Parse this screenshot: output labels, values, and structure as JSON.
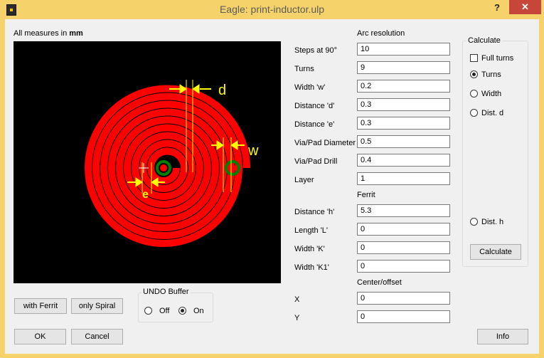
{
  "window": {
    "title": "Eagle: print-inductor.ulp",
    "help_label": "?",
    "close_label": "✕"
  },
  "preview": {
    "measures_prefix": "All measures in ",
    "measures_unit": "mm",
    "label_d": "d",
    "label_w": "w",
    "label_e": "e"
  },
  "arc": {
    "heading": "Arc resolution",
    "fields": [
      {
        "label": "Steps at 90°",
        "value": "10"
      },
      {
        "label": "Turns",
        "value": "9"
      },
      {
        "label": "Width 'w'",
        "value": "0.2"
      },
      {
        "label": "Distance 'd'",
        "value": "0.3"
      },
      {
        "label": "Distance 'e'",
        "value": "0.3"
      },
      {
        "label": "Via/Pad Diameter",
        "value": "0.5"
      },
      {
        "label": "Via/Pad Drill",
        "value": "0.4"
      },
      {
        "label": "Layer",
        "value": "1"
      }
    ]
  },
  "ferrit": {
    "heading": "Ferrit",
    "fields": [
      {
        "label": "Distance 'h'",
        "value": "5.3"
      },
      {
        "label": "Length 'L'",
        "value": "0"
      },
      {
        "label": "Width 'K'",
        "value": "0"
      },
      {
        "label": "Width 'K1'",
        "value": "0"
      }
    ]
  },
  "center": {
    "heading": "Center/offset",
    "fields": [
      {
        "label": "X",
        "value": "0"
      },
      {
        "label": "Y",
        "value": "0"
      }
    ]
  },
  "calculate": {
    "title": "Calculate",
    "full_turns": "Full turns",
    "full_turns_checked": false,
    "turns": "Turns",
    "width": "Width",
    "dist_d": "Dist. d",
    "dist_h": "Dist. h",
    "selected": "Turns",
    "button": "Calculate"
  },
  "buttons": {
    "with_ferrit": "with Ferrit",
    "only_spiral": "only Spiral",
    "ok": "OK",
    "cancel": "Cancel",
    "info": "Info"
  },
  "undo": {
    "title": "UNDO Buffer",
    "off": "Off",
    "on": "On",
    "selected": "On"
  },
  "colors": {
    "title_bar": "#f5d36a",
    "track": "#ff0000",
    "via": "#008000",
    "dimension": "#ffff00"
  }
}
